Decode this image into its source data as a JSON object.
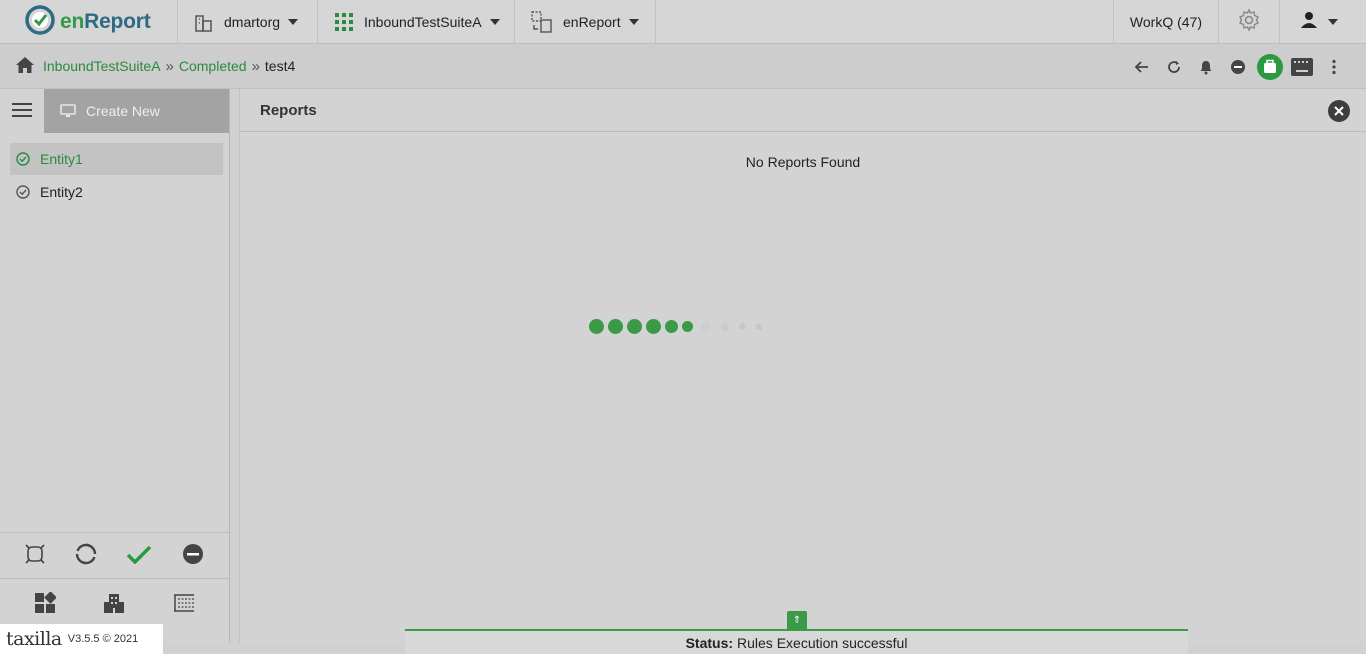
{
  "app": {
    "brand_name_prefix": "en",
    "brand_name_suffix": "Report"
  },
  "topbar": {
    "org_label": "dmartorg",
    "suite_label": "InboundTestSuiteA",
    "app_label": "enReport",
    "workq_label": "WorkQ (47)"
  },
  "breadcrumb": {
    "items": [
      {
        "label": "InboundTestSuiteA"
      },
      {
        "label": "Completed"
      }
    ],
    "current": "test4",
    "separator": "»"
  },
  "left": {
    "create_label": "Create New",
    "entities": [
      {
        "label": "Entity1",
        "active": true
      },
      {
        "label": "Entity2",
        "active": false
      }
    ]
  },
  "main": {
    "title": "Reports",
    "empty_message": "No Reports Found"
  },
  "footer": {
    "logo_text": "taxilla",
    "version": "V3.5.5 © 2021"
  },
  "status": {
    "label": "Status:",
    "message": "Rules Execution successful"
  },
  "colors": {
    "accent": "#3a9a48",
    "link": "#2b8a3e",
    "brand": "#2e6a82"
  }
}
